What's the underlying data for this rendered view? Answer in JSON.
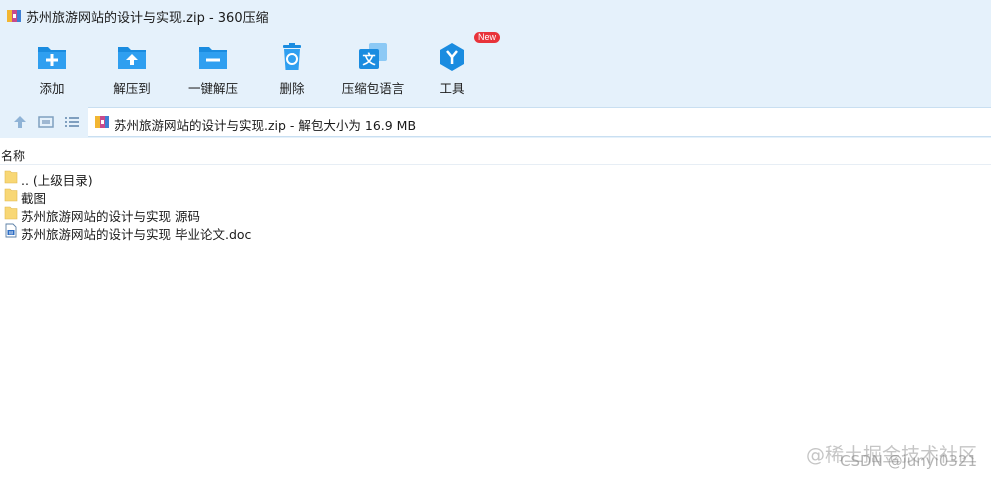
{
  "window": {
    "title": "苏州旅游网站的设计与实现.zip - 360压缩"
  },
  "toolbar": {
    "items": [
      {
        "label": "添加",
        "icon": "add-icon"
      },
      {
        "label": "解压到",
        "icon": "extract-to-icon"
      },
      {
        "label": "一键解压",
        "icon": "one-click-extract-icon"
      },
      {
        "label": "删除",
        "icon": "delete-icon"
      },
      {
        "label": "压缩包语言",
        "icon": "archive-language-icon"
      },
      {
        "label": "工具",
        "icon": "tools-icon",
        "badge": "New"
      }
    ]
  },
  "navbar": {
    "path": "苏州旅游网站的设计与实现.zip - 解包大小为 16.9 MB"
  },
  "list": {
    "column_name": "名称",
    "files": [
      {
        "name": ".. (上级目录)",
        "type": "folder"
      },
      {
        "name": "截图",
        "type": "folder"
      },
      {
        "name": "苏州旅游网站的设计与实现  源码",
        "type": "folder"
      },
      {
        "name": "苏州旅游网站的设计与实现 毕业论文.doc",
        "type": "doc"
      }
    ]
  },
  "watermark": {
    "line1": "@稀土掘金技术社区",
    "line2": "CSDN @junyi0321"
  },
  "colors": {
    "accent": "#1a8ce0",
    "toolbar_bg": "#e5f1fb",
    "folder": "#f8d775",
    "badge": "#e8333a"
  }
}
